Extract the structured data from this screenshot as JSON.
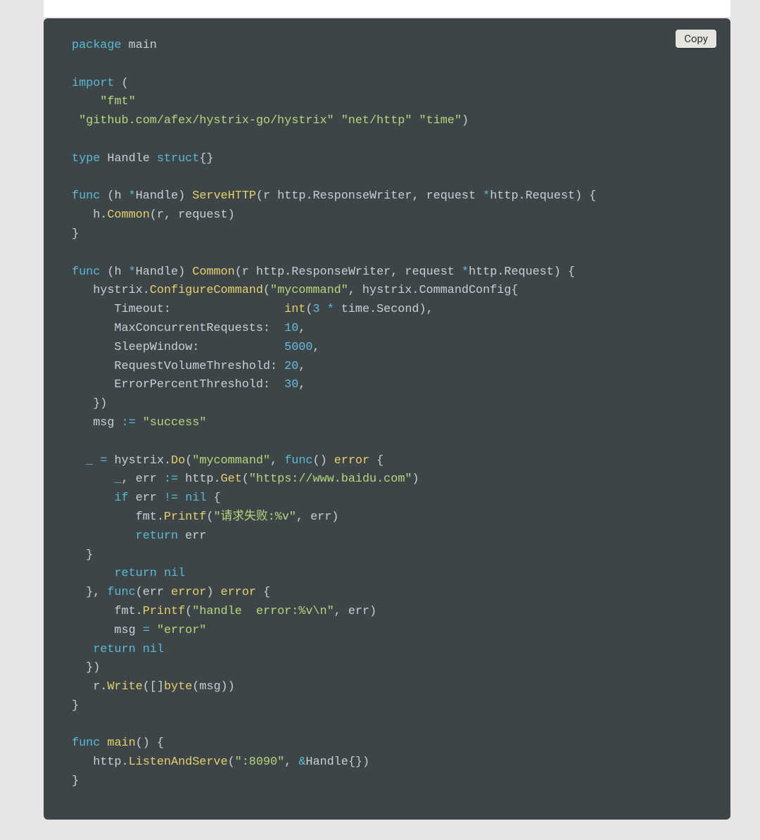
{
  "copy_button": "Copy",
  "tokens": [
    [
      [
        "kw",
        "package"
      ],
      [
        "id",
        " main"
      ]
    ],
    [],
    [
      [
        "kw",
        "import"
      ],
      [
        "id",
        " ("
      ]
    ],
    [
      [
        "id",
        "    "
      ],
      [
        "str",
        "\"fmt\""
      ]
    ],
    [
      [
        "id",
        " "
      ],
      [
        "str",
        "\"github.com/afex/hystrix-go/hystrix\""
      ],
      [
        "id",
        " "
      ],
      [
        "str",
        "\"net/http\""
      ],
      [
        "id",
        " "
      ],
      [
        "str",
        "\"time\""
      ],
      [
        "id",
        ")"
      ]
    ],
    [],
    [
      [
        "kw",
        "type"
      ],
      [
        "id",
        " Handle "
      ],
      [
        "kw",
        "struct"
      ],
      [
        "id",
        "{}"
      ]
    ],
    [],
    [
      [
        "kw",
        "func"
      ],
      [
        "id",
        " (h "
      ],
      [
        "op",
        "*"
      ],
      [
        "id",
        "Handle) "
      ],
      [
        "fn",
        "ServeHTTP"
      ],
      [
        "id",
        "(r http.ResponseWriter, request "
      ],
      [
        "op",
        "*"
      ],
      [
        "id",
        "http.Request) {"
      ]
    ],
    [
      [
        "id",
        "   h."
      ],
      [
        "fn",
        "Common"
      ],
      [
        "id",
        "(r, request)"
      ]
    ],
    [
      [
        "id",
        "}"
      ]
    ],
    [],
    [
      [
        "kw",
        "func"
      ],
      [
        "id",
        " (h "
      ],
      [
        "op",
        "*"
      ],
      [
        "id",
        "Handle) "
      ],
      [
        "fn",
        "Common"
      ],
      [
        "id",
        "(r http.ResponseWriter, request "
      ],
      [
        "op",
        "*"
      ],
      [
        "id",
        "http.Request) {"
      ]
    ],
    [
      [
        "id",
        "   hystrix."
      ],
      [
        "fn",
        "ConfigureCommand"
      ],
      [
        "id",
        "("
      ],
      [
        "str",
        "\"mycommand\""
      ],
      [
        "id",
        ", hystrix.CommandConfig{"
      ]
    ],
    [
      [
        "id",
        "      Timeout:                "
      ],
      [
        "type",
        "int"
      ],
      [
        "id",
        "("
      ],
      [
        "num",
        "3"
      ],
      [
        "id",
        " "
      ],
      [
        "op",
        "*"
      ],
      [
        "id",
        " time.Second),"
      ]
    ],
    [
      [
        "id",
        "      MaxConcurrentRequests:  "
      ],
      [
        "num",
        "10"
      ],
      [
        "id",
        ","
      ]
    ],
    [
      [
        "id",
        "      SleepWindow:            "
      ],
      [
        "num",
        "5000"
      ],
      [
        "id",
        ","
      ]
    ],
    [
      [
        "id",
        "      RequestVolumeThreshold: "
      ],
      [
        "num",
        "20"
      ],
      [
        "id",
        ","
      ]
    ],
    [
      [
        "id",
        "      ErrorPercentThreshold:  "
      ],
      [
        "num",
        "30"
      ],
      [
        "id",
        ","
      ]
    ],
    [
      [
        "id",
        "   })"
      ]
    ],
    [
      [
        "id",
        "   msg "
      ],
      [
        "op",
        ":="
      ],
      [
        "id",
        " "
      ],
      [
        "str",
        "\"success\""
      ]
    ],
    [],
    [
      [
        "id",
        "  "
      ],
      [
        "op",
        "_"
      ],
      [
        "id",
        " "
      ],
      [
        "op",
        "="
      ],
      [
        "id",
        " hystrix."
      ],
      [
        "fn",
        "Do"
      ],
      [
        "id",
        "("
      ],
      [
        "str",
        "\"mycommand\""
      ],
      [
        "id",
        ", "
      ],
      [
        "kw",
        "func"
      ],
      [
        "id",
        "() "
      ],
      [
        "type",
        "error"
      ],
      [
        "id",
        " {"
      ]
    ],
    [
      [
        "id",
        "      "
      ],
      [
        "op",
        "_"
      ],
      [
        "id",
        ", err "
      ],
      [
        "op",
        ":="
      ],
      [
        "id",
        " http."
      ],
      [
        "fn",
        "Get"
      ],
      [
        "id",
        "("
      ],
      [
        "str",
        "\"https://www.baidu.com\""
      ],
      [
        "id",
        ")"
      ]
    ],
    [
      [
        "id",
        "      "
      ],
      [
        "kw",
        "if"
      ],
      [
        "id",
        " err "
      ],
      [
        "op",
        "!="
      ],
      [
        "id",
        " "
      ],
      [
        "buil",
        "nil"
      ],
      [
        "id",
        " {"
      ]
    ],
    [
      [
        "id",
        "         fmt."
      ],
      [
        "fn",
        "Printf"
      ],
      [
        "id",
        "("
      ],
      [
        "str",
        "\"请求失败:%v\""
      ],
      [
        "id",
        ", err)"
      ]
    ],
    [
      [
        "id",
        "         "
      ],
      [
        "kw",
        "return"
      ],
      [
        "id",
        " err"
      ]
    ],
    [
      [
        "id",
        "  }"
      ]
    ],
    [
      [
        "id",
        "      "
      ],
      [
        "kw",
        "return"
      ],
      [
        "id",
        " "
      ],
      [
        "buil",
        "nil"
      ]
    ],
    [
      [
        "id",
        "  }, "
      ],
      [
        "kw",
        "func"
      ],
      [
        "id",
        "(err "
      ],
      [
        "type",
        "error"
      ],
      [
        "id",
        ") "
      ],
      [
        "type",
        "error"
      ],
      [
        "id",
        " {"
      ]
    ],
    [
      [
        "id",
        "      fmt."
      ],
      [
        "fn",
        "Printf"
      ],
      [
        "id",
        "("
      ],
      [
        "str",
        "\"handle  error:%v\\n\""
      ],
      [
        "id",
        ", err)"
      ]
    ],
    [
      [
        "id",
        "      msg "
      ],
      [
        "op",
        "="
      ],
      [
        "id",
        " "
      ],
      [
        "str",
        "\"error\""
      ]
    ],
    [
      [
        "id",
        "   "
      ],
      [
        "kw",
        "return"
      ],
      [
        "id",
        " "
      ],
      [
        "buil",
        "nil"
      ]
    ],
    [
      [
        "id",
        "  })"
      ]
    ],
    [
      [
        "id",
        "   r."
      ],
      [
        "fn",
        "Write"
      ],
      [
        "id",
        "([]"
      ],
      [
        "type",
        "byte"
      ],
      [
        "id",
        "(msg))"
      ]
    ],
    [
      [
        "id",
        "}"
      ]
    ],
    [],
    [
      [
        "kw",
        "func"
      ],
      [
        "id",
        " "
      ],
      [
        "fn",
        "main"
      ],
      [
        "id",
        "() {"
      ]
    ],
    [
      [
        "id",
        "   http."
      ],
      [
        "fn",
        "ListenAndServe"
      ],
      [
        "id",
        "("
      ],
      [
        "str",
        "\":8090\""
      ],
      [
        "id",
        ", "
      ],
      [
        "op",
        "&"
      ],
      [
        "id",
        "Handle{})"
      ]
    ],
    [
      [
        "id",
        "}"
      ]
    ]
  ]
}
